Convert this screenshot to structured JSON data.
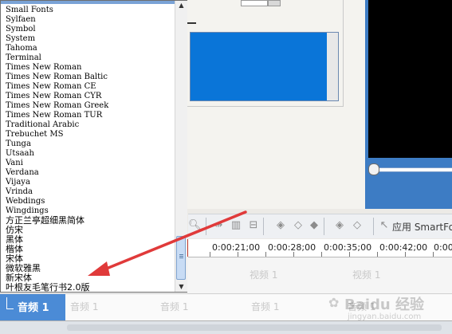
{
  "font_list": {
    "items": [
      "Small Fonts",
      "Sylfaen",
      "Symbol",
      "System",
      "Tahoma",
      "Terminal",
      "Times New Roman",
      "Times New Roman Baltic",
      "Times New Roman CE",
      "Times New Roman CYR",
      "Times New Roman Greek",
      "Times New Roman TUR",
      "Traditional Arabic",
      "Trebuchet MS",
      "Tunga",
      "Utsaah",
      "Vani",
      "Verdana",
      "Vijaya",
      "Vrinda",
      "Webdings",
      "Wingdings",
      "方正兰亭超细黑简体",
      "仿宋",
      "黑体",
      "楷体",
      "宋体",
      "微软雅黑",
      "新宋体",
      "叶根友毛笔行书2.0版"
    ]
  },
  "toolbar": {
    "apply_label": "应用 SmartFo"
  },
  "ruler": {
    "labels": [
      "0:00:21;00",
      "0:00:28;00",
      "0:00:35;00",
      "0:00:42;00",
      "0:00:4"
    ]
  },
  "tracks": {
    "video_clip_label": "视频 1",
    "audio_track_name": "音频 1",
    "audio_clip_label": "音频 1"
  },
  "watermark": {
    "brand": "Baidu 经验",
    "url": "jingyan.baidu.com"
  },
  "colors": {
    "arrow": "#e03a3a",
    "selection": "#0a75d8",
    "audio_header": "#4b8bd6"
  }
}
